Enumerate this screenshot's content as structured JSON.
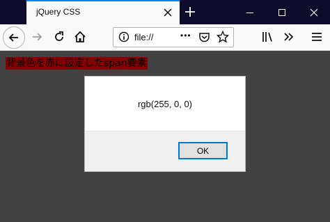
{
  "tab": {
    "title": "jQuery CSS"
  },
  "toolbar": {
    "url": "file://",
    "overflow": "•••"
  },
  "content": {
    "span_text": "背景色を赤に設定したspan要素"
  },
  "dialog": {
    "message": "rgb(255, 0, 0)",
    "ok_label": "OK"
  },
  "icons": {
    "tab_close": "close-icon",
    "new_tab": "plus-icon",
    "minimize": "minimize-icon",
    "maximize": "maximize-icon",
    "close_window": "close-icon",
    "back": "back-arrow-icon",
    "forward": "forward-arrow-icon",
    "reload": "reload-icon",
    "home": "home-icon",
    "info": "info-icon",
    "pocket": "pocket-icon",
    "bookmark": "star-icon",
    "library": "library-icon",
    "more": "chevron-double-right-icon",
    "menu": "hamburger-menu-icon"
  },
  "colors": {
    "accent": "#0a84ff",
    "span_background": "#ff0000",
    "titlebar": "#0c0c2a",
    "ok_border": "#0078d7"
  }
}
